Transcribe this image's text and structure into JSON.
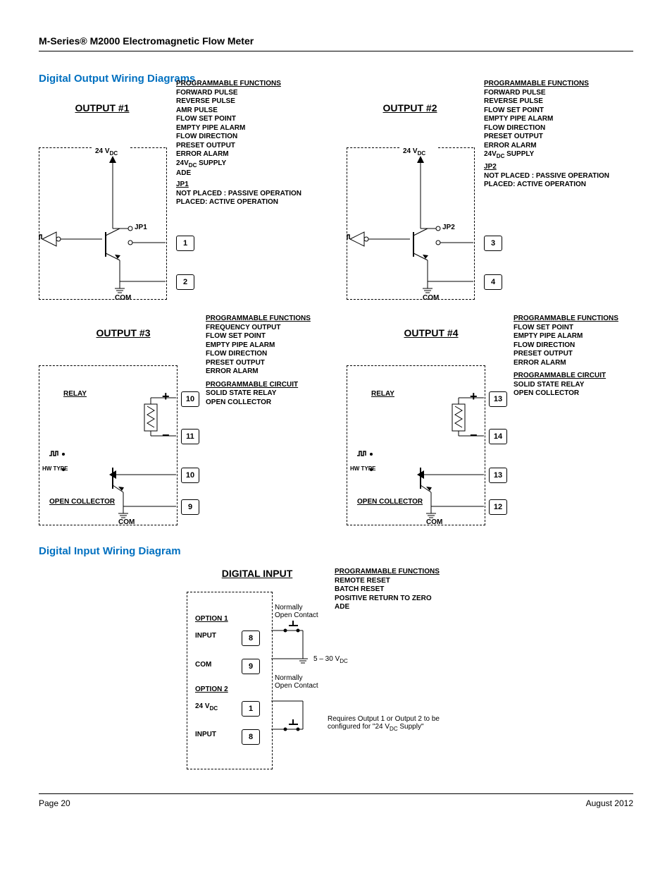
{
  "header": {
    "title": "M-Series® M2000 Electromagnetic Flow Meter"
  },
  "section1": {
    "title": "Digital Output Wiring Diagrams"
  },
  "section2": {
    "title": "Digital Input Wiring Diagram"
  },
  "footer": {
    "page": "Page 20",
    "date": "August 2012"
  },
  "output1": {
    "title": "OUTPUT #1",
    "supply": "24 V",
    "supply_sub": "DC",
    "jp": "JP1",
    "com": "COM",
    "terms": [
      "1",
      "2"
    ],
    "func_heading": "PROGRAMMABLE FUNCTIONS",
    "funcs": [
      "FORWARD PULSE",
      "REVERSE PULSE",
      "AMR PULSE",
      "FLOW SET POINT",
      "EMPTY PIPE ALARM",
      "FLOW DIRECTION",
      "PRESET OUTPUT",
      "ERROR ALARM",
      "24V_DC SUPPLY",
      "ADE"
    ],
    "jp_heading": "JP1",
    "jp_notplaced": "NOT PLACED :  PASSIVE OPERATION",
    "jp_placed": "PLACED:            ACTIVE OPERATION"
  },
  "output2": {
    "title": "OUTPUT #2",
    "supply": "24 V",
    "supply_sub": "DC",
    "jp": "JP2",
    "com": "COM",
    "terms": [
      "3",
      "4"
    ],
    "func_heading": "PROGRAMMABLE FUNCTIONS",
    "funcs": [
      "FORWARD PULSE",
      "REVERSE PULSE",
      "FLOW SET POINT",
      "EMPTY PIPE ALARM",
      "FLOW DIRECTION",
      "PRESET OUTPUT",
      "ERROR ALARM",
      "24V_DC SUPPLY"
    ],
    "jp_heading": "JP2",
    "jp_notplaced": "NOT PLACED :  PASSIVE OPERATION",
    "jp_placed": "PLACED:            ACTIVE OPERATION"
  },
  "output3": {
    "title": "OUTPUT #3",
    "relay": "RELAY",
    "hw": "HW TYPE",
    "oc": "OPEN COLLECTOR",
    "com": "COM",
    "terms": [
      "10",
      "11",
      "10",
      "9"
    ],
    "func_heading": "PROGRAMMABLE FUNCTIONS",
    "funcs": [
      "FREQUENCY OUTPUT",
      "FLOW SET POINT",
      "EMPTY PIPE ALARM",
      "FLOW DIRECTION",
      "PRESET OUTPUT",
      "ERROR ALARM"
    ],
    "circ_heading": "PROGRAMMABLE CIRCUIT",
    "circs": [
      "SOLID STATE RELAY",
      "OPEN COLLECTOR"
    ]
  },
  "output4": {
    "title": "OUTPUT #4",
    "relay": "RELAY",
    "hw": "HW TYPE",
    "oc": "OPEN COLLECTOR",
    "com": "COM",
    "terms": [
      "13",
      "14",
      "13",
      "12"
    ],
    "func_heading": "PROGRAMMABLE FUNCTIONS",
    "funcs": [
      "FLOW SET POINT",
      "EMPTY PIPE ALARM",
      "FLOW DIRECTION",
      "PRESET OUTPUT",
      "ERROR ALARM"
    ],
    "circ_heading": "PROGRAMMABLE CIRCUIT",
    "circs": [
      "SOLID STATE RELAY",
      "OPEN COLLECTOR"
    ]
  },
  "input": {
    "title": "DIGITAL INPUT",
    "opt1": "OPTION 1",
    "opt2": "OPTION 2",
    "input_lbl": "INPUT",
    "com_lbl": "COM",
    "dc24": "24 V",
    "dc24_sub": "DC",
    "noc": "Normally\nOpen Contact",
    "range": "5 – 30 V",
    "range_sub": "DC",
    "req": "Requires Output 1 or Output 2 to be\nconfigured for \"24 V_DC Supply\"",
    "terms": [
      "8",
      "9",
      "1",
      "8"
    ],
    "func_heading": "PROGRAMMABLE FUNCTIONS",
    "funcs": [
      "REMOTE RESET",
      "BATCH RESET",
      "POSITIVE RETURN TO ZERO",
      "ADE"
    ]
  }
}
